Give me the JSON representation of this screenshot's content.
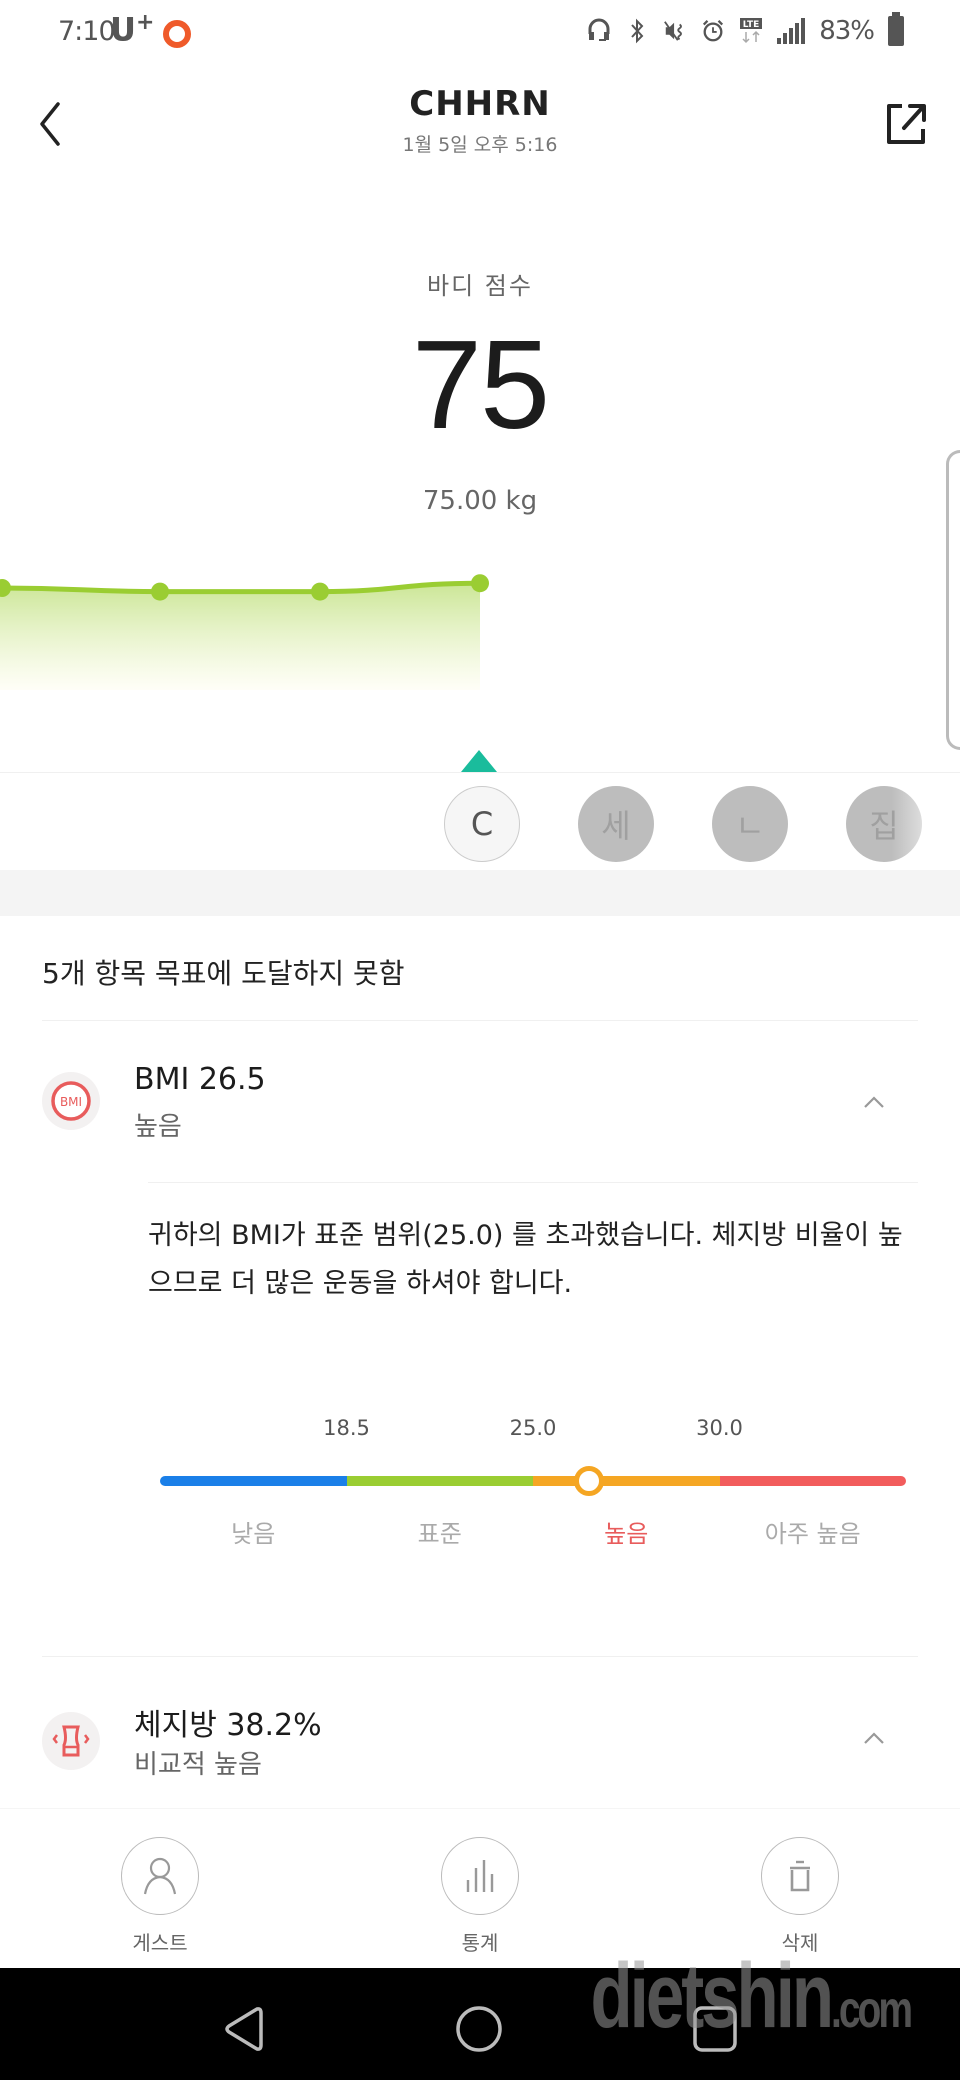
{
  "status_bar": {
    "time": "7:10",
    "carrier": "U",
    "carrier_plus": "+",
    "battery": "83%",
    "icons": [
      "headset-icon",
      "bluetooth-icon",
      "mute-vibrate-icon",
      "alarm-icon",
      "lte-icon",
      "signal-icon",
      "battery-icon"
    ]
  },
  "header": {
    "title": "CHHRN",
    "subtitle": "1월 5일 오후 5:16",
    "back_icon": "chevron-left-icon",
    "share_icon": "share-external-icon"
  },
  "score": {
    "label": "바디 점수",
    "value": "75",
    "weight": "75.00 kg"
  },
  "trend": {
    "color": "#9acd32",
    "points": [
      75.0,
      74.7,
      74.7,
      75.4
    ],
    "y_range": [
      70,
      80
    ]
  },
  "users": [
    {
      "initial": "C",
      "active": true
    },
    {
      "initial": "세",
      "active": false
    },
    {
      "initial": "ㄴ",
      "active": false
    },
    {
      "initial": "집",
      "active": false
    }
  ],
  "summary": {
    "title": "5개 항목 목표에 도달하지 못함"
  },
  "metrics": [
    {
      "icon": "bmi-icon",
      "icon_text": "BMI",
      "name": "BMI  26.5",
      "status": "높음",
      "expanded": true,
      "description": "귀하의 BMI가 표준 범위(25.0) 를 초과했습니다. 체지방 비율이 높으므로 더 많은 운동을 하셔야 합니다.",
      "scale": {
        "min": 12.0,
        "max": 36.0,
        "value": 26.5,
        "ticks": [
          "18.5",
          "25.0",
          "30.0"
        ],
        "tick_values": [
          18.5,
          25.0,
          30.0
        ],
        "segments": [
          {
            "label": "낮음",
            "color": "#1a7fe8"
          },
          {
            "label": "표준",
            "color": "#9acd32"
          },
          {
            "label": "높음",
            "color": "#f5a623"
          },
          {
            "label": "아주 높음",
            "color": "#f25c5c"
          }
        ],
        "current_segment": 2
      }
    },
    {
      "icon": "body-fat-icon",
      "name": "체지방  38.2%",
      "status": "비교적 높음",
      "expanded": false
    }
  ],
  "actions": [
    {
      "label": "게스트",
      "icon": "user-icon"
    },
    {
      "label": "통계",
      "icon": "bar-chart-icon"
    },
    {
      "label": "삭제",
      "icon": "trash-icon"
    }
  ],
  "nav": {
    "back_icon": "nav-back-icon",
    "home_icon": "nav-home-icon",
    "recents_icon": "nav-recents-icon"
  },
  "watermark": {
    "text": "dietshin",
    "suffix": ".com"
  }
}
